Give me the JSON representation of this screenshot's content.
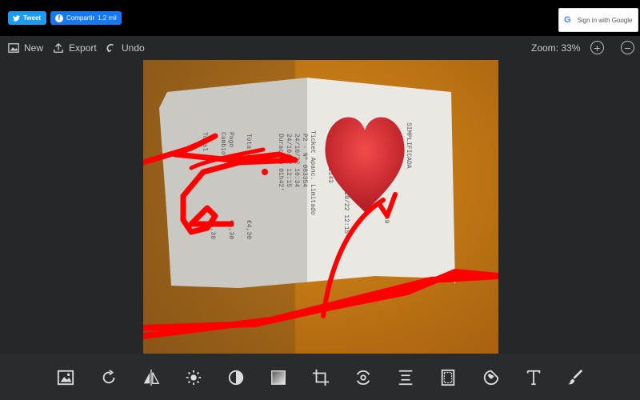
{
  "social": {
    "tweet_label": "Tweet",
    "share_label": "Compartir",
    "share_count": "1,2 mil",
    "google_label": "Sign in with Google"
  },
  "toolbar": {
    "new_label": "New",
    "export_label": "Export",
    "undo_label": "Undo",
    "zoom_label": "Zoom: 33%"
  },
  "receipt": {
    "line1": "SIMPLIFICADA",
    "line2": "24/10/22 12:15",
    "line3": "Ticket Apanc. Limitado",
    "line4": "P2 - Nº 083354",
    "line5": "24/10/22 10:34",
    "line6": "24/10/22 12:15",
    "line7": "Duración 01h42'",
    "line8": "Total",
    "line9": "€4,30",
    "line10": "€4,30",
    "line11": "Pago",
    "line12": "Cambio",
    "line13": "Total",
    "line14": "€4,30",
    "line15": "121143",
    "line16": "049"
  },
  "colors": {
    "background": "#262729",
    "accent_red": "#ff0000",
    "heart": "#d42a2a",
    "table_orange": "#c57d14"
  },
  "bottom_tools": [
    "image-icon",
    "rotate-icon",
    "flip-icon",
    "brightness-icon",
    "contrast-icon",
    "gradient-icon",
    "crop-icon",
    "perspective-icon",
    "align-icon",
    "frame-icon",
    "sticker-icon",
    "text-icon",
    "brush-icon"
  ]
}
